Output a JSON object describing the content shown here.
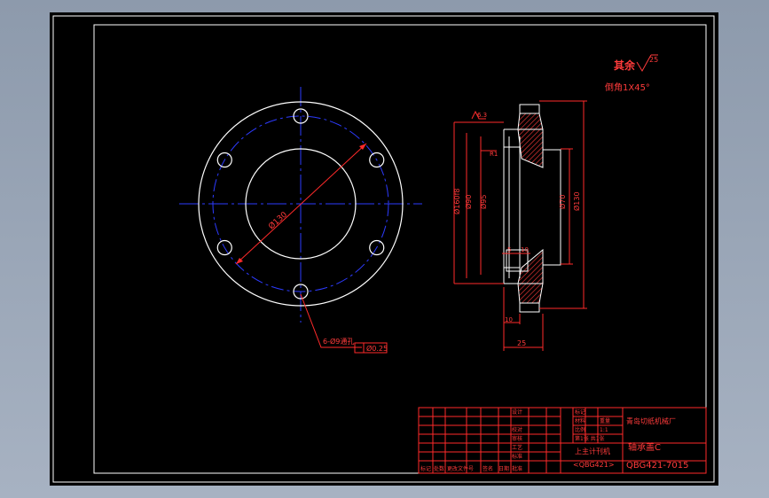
{
  "surface_finish": {
    "rest_label": "其余",
    "roughness": "25"
  },
  "chamfer_note": "倒角1X45°",
  "front_view": {
    "pcd_label": "Ø130",
    "hole_note": "6-Ø9通孔",
    "hole_spec": "Ø0.25"
  },
  "section_view": {
    "dia_outer": "Ø160f8",
    "dia_recess": "Ø90",
    "dia_bore": "Ø95",
    "dia_hub": "Ø70",
    "dia_face": "Ø130",
    "top_dim": "6.3",
    "radius": "R1",
    "step_a": "5",
    "step_b": "10",
    "bottom_dim": "10",
    "length": "25"
  },
  "title_block": {
    "company": "青岛切纸机械厂",
    "part_name": "轴承盖C",
    "drawing_no": "QBG421-7015",
    "assembly_name": "上主计刊机",
    "assembly_code": "<QBG421>",
    "scale": "1:1",
    "labels": {
      "design": "设计",
      "check": "校对",
      "review": "审核",
      "craft": "工艺",
      "standard": "标准",
      "approve": "批准",
      "material": "材料",
      "weight": "重量",
      "mark": "标记",
      "quantity": "数量",
      "ratio": "比例",
      "sheet": "第1张 共1张",
      "rev_mark": "标记",
      "rev_count": "处数",
      "rev_doc": "更改文件号",
      "rev_sign": "签名",
      "rev_date": "日期"
    }
  },
  "colors": {
    "outline": "#ffffff",
    "centerline": "#2d3bff",
    "dimension": "#ff2a2a",
    "hatch": "#ff3b3b"
  }
}
